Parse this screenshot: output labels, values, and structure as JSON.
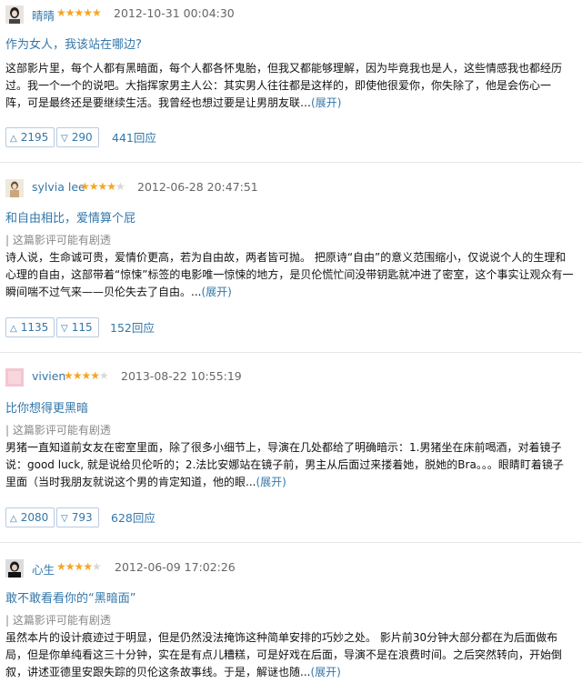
{
  "reviews": [
    {
      "username": "晴晴",
      "rating": 5,
      "time": "2012-10-31 00:04:30",
      "title": "作为女人，我该站在哪边?",
      "spoiler": "",
      "body": [
        "这部影片里，每个人都有黑暗面，每个人都各怀鬼胎，但我又都能够理解，因为毕竟我也是人，这些情感我也都经历",
        "过。我一个一个的说吧。大指挥家男主人公：其实男人往往都是这样的，即使他很爱你，你失除了，他是会伤心一",
        "阵，可是最终还是要继续生活。我曾经也想过要是让男朋友联…"
      ],
      "expand": "(展开)",
      "up": "2195",
      "down": "290",
      "replies": "441回应"
    },
    {
      "username": "sylvia lee",
      "rating": 4,
      "time": "2012-06-28 20:47:51",
      "title": "和自由相比，爱情算个屁",
      "spoiler": "这篇影评可能有剧透",
      "body": [
        "诗人说，生命诚可贵，爱情价更高，若为自由故，两者皆可抛。 把原诗“自由”的意义范围缩小，仅说说个人的生理和",
        "心理的自由，这部带着“惊悚”标签的电影唯一惊悚的地方，是贝伦慌忙间没带钥匙就冲进了密室，这个事实让观众有一",
        "瞬间喘不过气来——贝伦失去了自由。..."
      ],
      "expand": "(展开)",
      "up": "1135",
      "down": "115",
      "replies": "152回应"
    },
    {
      "username": "vivien",
      "rating": 4,
      "time": "2013-08-22 10:55:19",
      "title": "比你想得更黑暗",
      "spoiler": "这篇影评可能有剧透",
      "body": [
        "男猪一直知道前女友在密室里面，除了很多小细节上，导演在几处都给了明确暗示：1.男猪坐在床前喝酒，对着镜子",
        "说：good luck, 就是说给贝伦听的；2.法比安娜站在镜子前，男主从后面过来搂着她，脱她的Bra。。。眼睛盯着镜子",
        "里面（当时我朋友就说这个男的肯定知道，他的眼..."
      ],
      "expand": "(展开)",
      "up": "2080",
      "down": "793",
      "replies": "628回应"
    },
    {
      "username": "心生",
      "rating": 4,
      "time": "2012-06-09 17:02:26",
      "title": "敢不敢看看你的“黑暗面”",
      "spoiler": "这篇影评可能有剧透",
      "body": [
        "虽然本片的设计痕迹过于明显，但是仍然没法掩饰这种简单安排的巧妙之处。 影片前30分钟大部分都在为后面做布",
        "局，但是你单纯看这三十分钟，实在是有点儿糟糕，可是好戏在后面，导演不是在浪费时间。之后突然转向，开始倒",
        "叙，讲述亚德里安跟失踪的贝伦这条故事线。于是，解谜也随..."
      ],
      "expand": "(展开)",
      "up": "",
      "down": "",
      "replies": ""
    }
  ]
}
